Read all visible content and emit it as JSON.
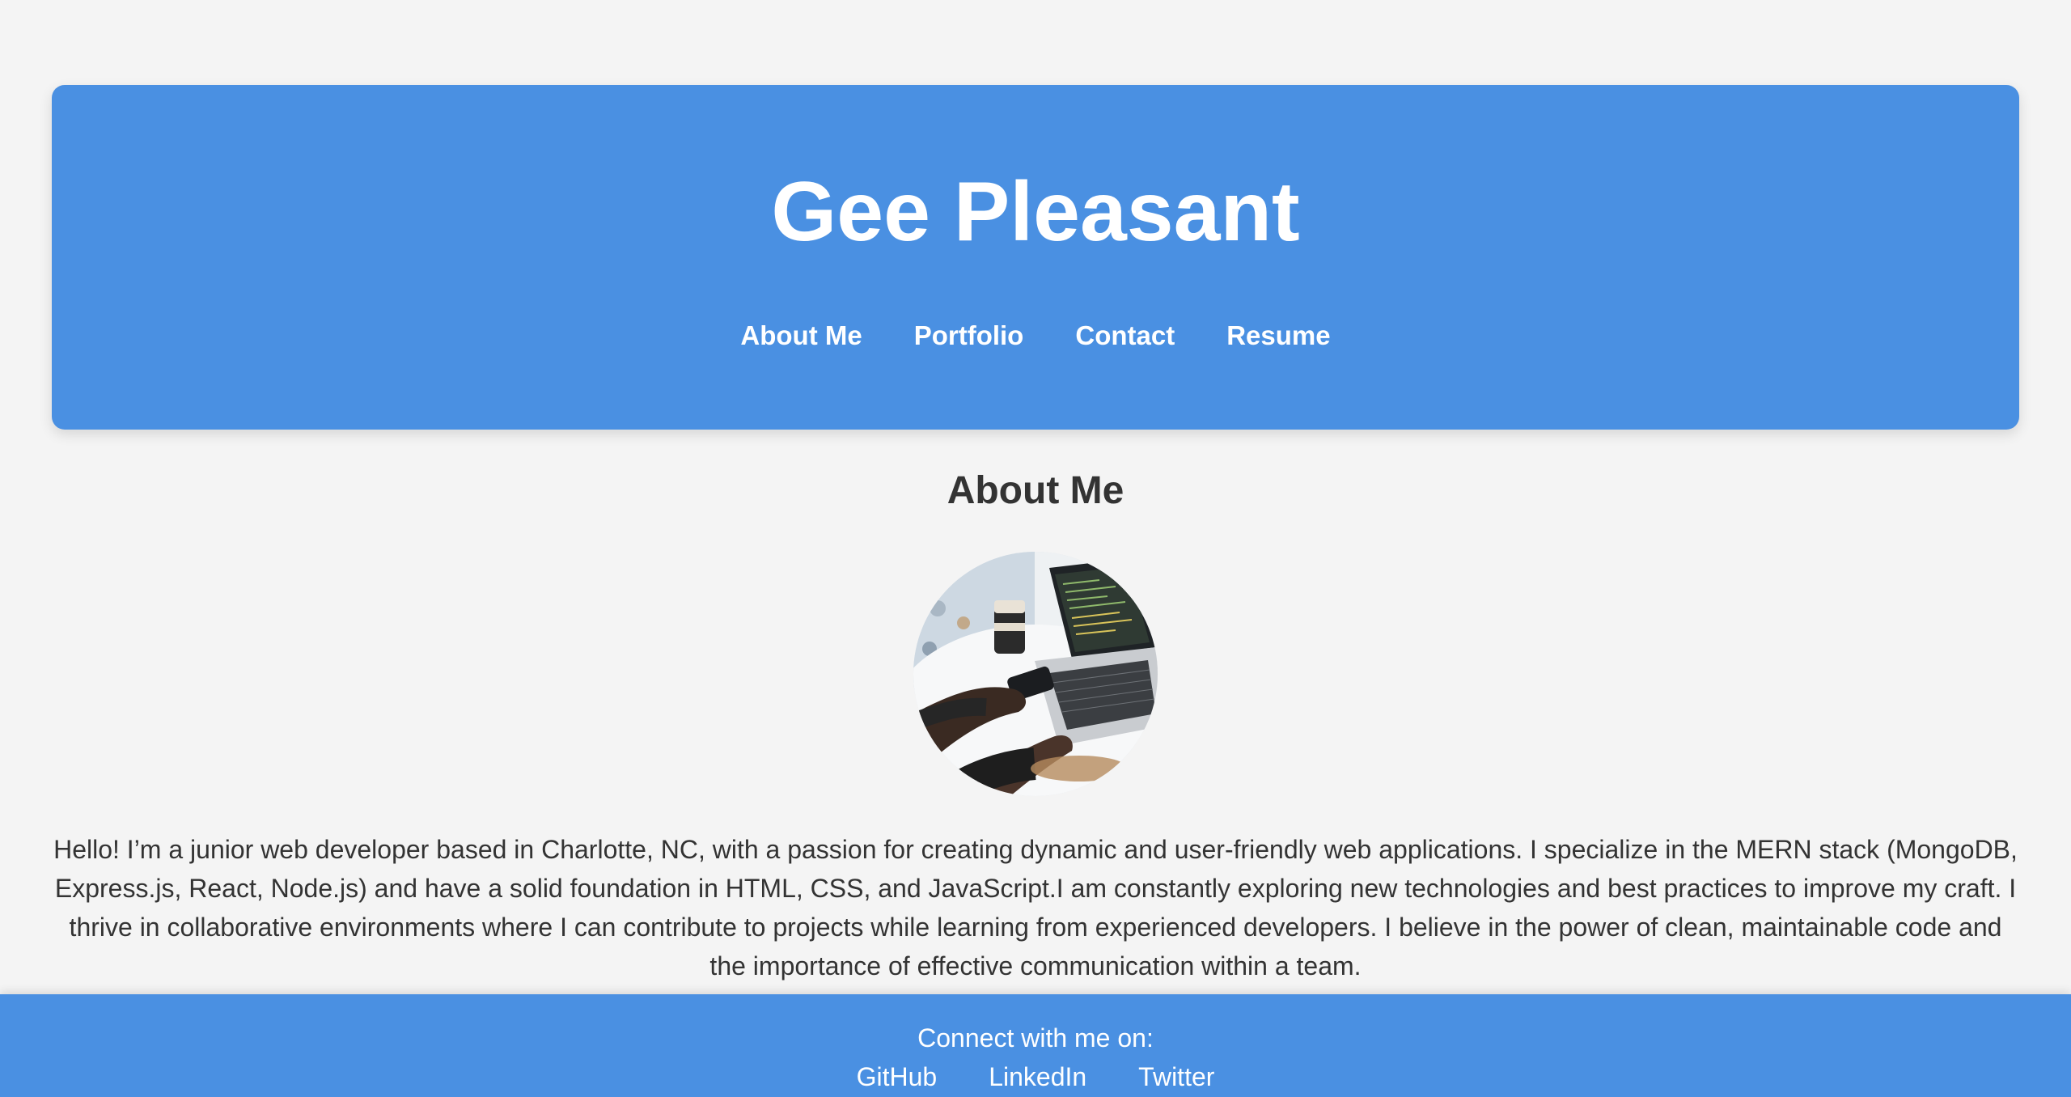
{
  "header": {
    "title": "Gee Pleasant",
    "nav": [
      {
        "label": "About Me"
      },
      {
        "label": "Portfolio"
      },
      {
        "label": "Contact"
      },
      {
        "label": "Resume"
      }
    ]
  },
  "about": {
    "heading": "About Me",
    "photo_icon": "laptop-workspace-photo",
    "text": "Hello! I’m a junior web developer based in Charlotte, NC, with a passion for creating dynamic and user-friendly web applications. I specialize in the MERN stack (MongoDB, Express.js, React, Node.js) and have a solid foundation in HTML, CSS, and JavaScript.I am constantly exploring new technologies and best practices to improve my craft. I thrive in collaborative environments where I can contribute to projects while learning from experienced developers. I believe in the power of clean, maintainable code and the importance of effective communication within a team."
  },
  "footer": {
    "connect_label": "Connect with me on:",
    "links": [
      {
        "label": "GitHub"
      },
      {
        "label": "LinkedIn"
      },
      {
        "label": "Twitter"
      }
    ]
  },
  "colors": {
    "accent": "#4a90e2",
    "background": "#f4f4f4",
    "text": "#333333"
  }
}
